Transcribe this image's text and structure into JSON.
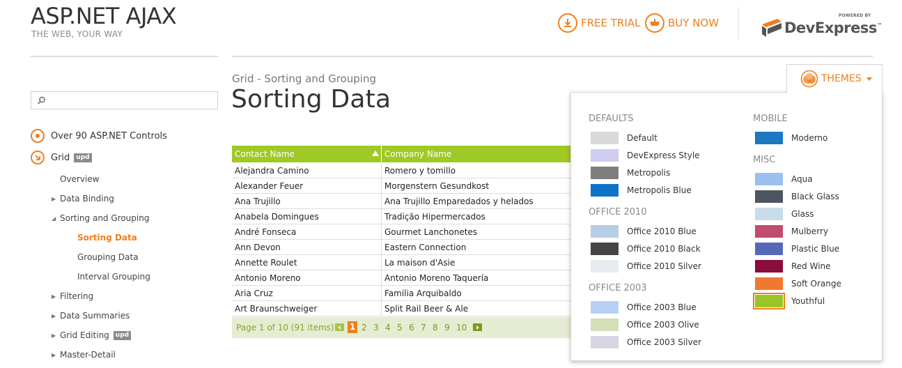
{
  "brand": {
    "title": "ASP.NET AJAX",
    "subtitle": "THE WEB, YOUR WAY"
  },
  "header": {
    "free_trial": "FREE TRIAL",
    "buy_now": "BUY NOW",
    "logo_powered": "POWERED BY",
    "logo_name": "DevExpress",
    "logo_trademark": "™"
  },
  "search": {
    "placeholder": "",
    "value": ""
  },
  "nav": {
    "top": [
      {
        "label": "Over 90 ASP.NET Controls"
      },
      {
        "label": "Grid",
        "badge": "upd"
      }
    ],
    "items": [
      {
        "label": "Overview",
        "expand": ""
      },
      {
        "label": "Data Binding",
        "expand": "▶"
      },
      {
        "label": "Sorting and Grouping",
        "expand": "◢"
      },
      {
        "label": "Sorting Data",
        "expand": ""
      },
      {
        "label": "Grouping Data",
        "expand": ""
      },
      {
        "label": "Interval Grouping",
        "expand": ""
      },
      {
        "label": "Filtering",
        "expand": "▶"
      },
      {
        "label": "Data Summaries",
        "expand": "▶"
      },
      {
        "label": "Grid Editing",
        "expand": "▶",
        "badge": "upd"
      },
      {
        "label": "Master-Detail",
        "expand": "▶"
      }
    ]
  },
  "content": {
    "breadcrumb": "Grid - Sorting and Grouping",
    "title": "Sorting Data"
  },
  "grid": {
    "columns": [
      "Contact Name",
      "Company Name"
    ],
    "rows": [
      [
        "Alejandra Camino",
        "Romero y tomillo"
      ],
      [
        "Alexander Feuer",
        "Morgenstern Gesundkost"
      ],
      [
        "Ana Trujillo",
        "Ana Trujillo Emparedados y helados"
      ],
      [
        "Anabela Domingues",
        "Tradição Hipermercados"
      ],
      [
        "André Fonseca",
        "Gourmet Lanchonetes"
      ],
      [
        "Ann Devon",
        "Eastern Connection"
      ],
      [
        "Annette Roulet",
        "La maison d'Asie"
      ],
      [
        "Antonio Moreno",
        "Antonio Moreno Taquería"
      ],
      [
        "Aria Cruz",
        "Familia Arquibaldo"
      ],
      [
        "Art Braunschweiger",
        "Split Rail Beer & Ale"
      ]
    ],
    "pager": {
      "info": "Page 1 of 10 (91 items)",
      "pages": [
        "1",
        "2",
        "3",
        "4",
        "5",
        "6",
        "7",
        "8",
        "9",
        "10"
      ]
    }
  },
  "themes": {
    "button": "THEMES",
    "groups": {
      "defaults": "DEFAULTS",
      "office2010": "OFFICE 2010",
      "office2003": "OFFICE 2003",
      "mobile": "MOBILE",
      "misc": "MISC"
    },
    "left": [
      {
        "name": "Default",
        "color": "#d9d9d9"
      },
      {
        "name": "DevExpress Style",
        "color": "#cfcdf0"
      },
      {
        "name": "Metropolis",
        "color": "#7f7f7f"
      },
      {
        "name": "Metropolis Blue",
        "color": "#0f72c9"
      },
      {
        "name": "Office 2010 Blue",
        "color": "#b8cde6"
      },
      {
        "name": "Office 2010 Black",
        "color": "#454545"
      },
      {
        "name": "Office 2010 Silver",
        "color": "#e7eaee"
      },
      {
        "name": "Office 2003 Blue",
        "color": "#b7d1f5"
      },
      {
        "name": "Office 2003 Olive",
        "color": "#d3dfb8"
      },
      {
        "name": "Office 2003 Silver",
        "color": "#d6d5e2"
      }
    ],
    "right": [
      {
        "name": "Moderno",
        "color": "#1a78c4"
      },
      {
        "name": "Aqua",
        "color": "#9bbfee"
      },
      {
        "name": "Black Glass",
        "color": "#4d5660"
      },
      {
        "name": "Glass",
        "color": "#c9dceb"
      },
      {
        "name": "Mulberry",
        "color": "#c04c6e"
      },
      {
        "name": "Plastic Blue",
        "color": "#5569b8"
      },
      {
        "name": "Red Wine",
        "color": "#8a0c3a"
      },
      {
        "name": "Soft Orange",
        "color": "#f07932"
      },
      {
        "name": "Youthful",
        "color": "#9bc527",
        "selected": true
      }
    ]
  },
  "colors": {
    "accent": "#f07f1c",
    "grid_header": "#9fc925"
  }
}
